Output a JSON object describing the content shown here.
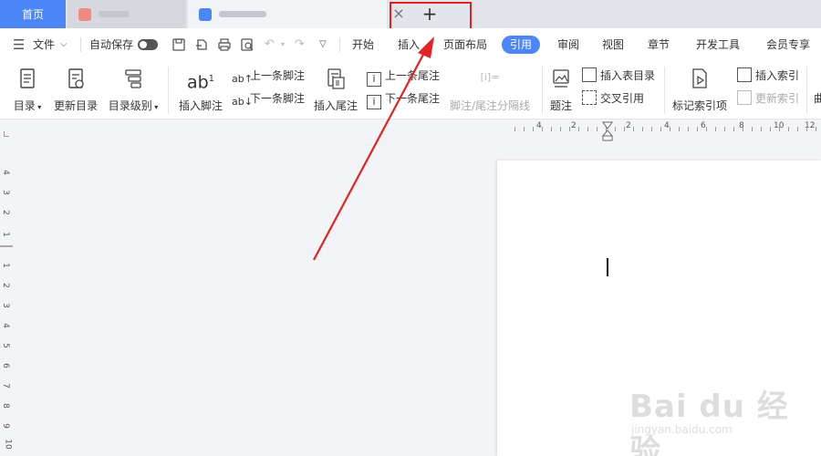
{
  "tabs": {
    "home_label": "首页",
    "close_glyph": "×",
    "new_tab_glyph": "+"
  },
  "menu": {
    "file": "文件",
    "autosave": "自动保存",
    "tabs": [
      "开始",
      "插入",
      "页面布局",
      "引用",
      "审阅",
      "视图",
      "章节",
      "开发工具",
      "会员专享"
    ],
    "active_tab": "引用"
  },
  "ribbon": {
    "toc": "目录",
    "update_toc": "更新目录",
    "toc_level": "目录级别",
    "insert_footnote": "插入脚注",
    "prev_footnote": "上一条脚注",
    "next_footnote": "下一条脚注",
    "insert_endnote": "插入尾注",
    "prev_endnote": "上一条尾注",
    "next_endnote": "下一条尾注",
    "separator_line": "脚注/尾注分隔线",
    "caption": "题注",
    "insert_table_of_figures": "插入表目录",
    "cross_reference": "交叉引用",
    "mark_index_entry": "标记索引项",
    "insert_index": "插入索引",
    "update_index": "更新索引"
  },
  "rulers": {
    "horizontal": [
      "4",
      "2",
      "2",
      "4",
      "6",
      "8",
      "10",
      "12"
    ],
    "vertical": [
      "4",
      "3",
      "2",
      "1",
      "1",
      "2",
      "3",
      "4",
      "5",
      "6",
      "7",
      "8",
      "9",
      "10"
    ]
  },
  "watermark": {
    "brand": "Bai du 经验",
    "url": "jingyan.baidu.com"
  },
  "colors": {
    "accent": "#4d86f7",
    "annotation_red": "#e52222"
  }
}
